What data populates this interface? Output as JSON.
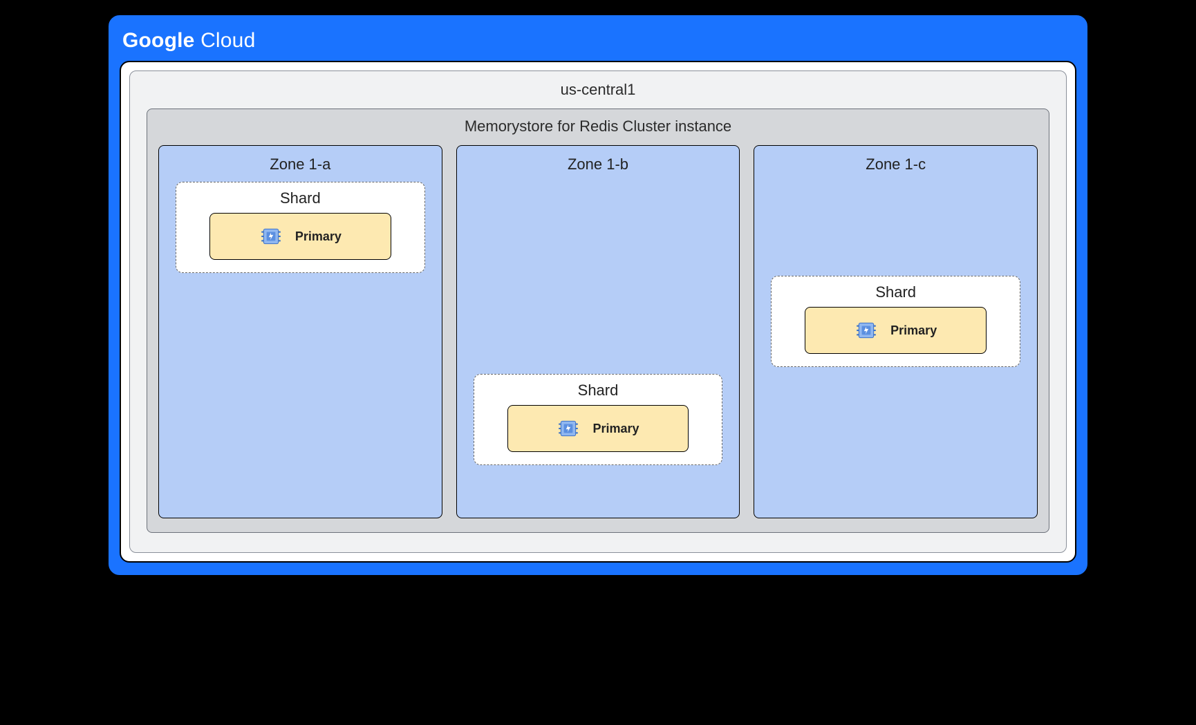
{
  "header": {
    "brand_bold": "Google",
    "brand_light": " Cloud"
  },
  "region": {
    "name": "us-central1"
  },
  "instance": {
    "title": "Memorystore for Redis Cluster instance"
  },
  "zones": [
    {
      "label": "Zone 1-a",
      "shard": {
        "title": "Shard",
        "node_label": "Primary",
        "pos": "top"
      }
    },
    {
      "label": "Zone 1-b",
      "shard": {
        "title": "Shard",
        "node_label": "Primary",
        "pos": "bottom"
      }
    },
    {
      "label": "Zone 1-c",
      "shard": {
        "title": "Shard",
        "node_label": "Primary",
        "pos": "mid"
      }
    }
  ],
  "colors": {
    "accent": "#1a73ff",
    "zone_bg": "#b5cdf7",
    "node_bg": "#fde9b1",
    "instance_bg": "#d5d7da",
    "region_bg": "#f1f2f3"
  }
}
